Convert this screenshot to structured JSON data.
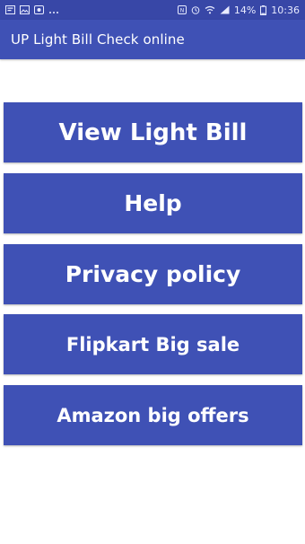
{
  "status_bar": {
    "battery": "14%",
    "time": "10:36",
    "icons": [
      "notification-icon",
      "image-icon",
      "screen-record-icon",
      "more-notifications-icon",
      "nfc-icon",
      "alarm-icon",
      "wifi-icon",
      "signal-icon",
      "battery-icon"
    ]
  },
  "app_bar": {
    "title": "UP Light Bill Check online"
  },
  "menu": {
    "items": [
      {
        "label": "View Light Bill"
      },
      {
        "label": "Help"
      },
      {
        "label": "Privacy policy"
      },
      {
        "label": "Flipkart Big sale"
      },
      {
        "label": "Amazon big offers"
      }
    ]
  },
  "colors": {
    "primary": "#3f51b5",
    "primary_dark": "#3847a7",
    "background": "#ffffff",
    "text_on_primary": "#ffffff"
  }
}
